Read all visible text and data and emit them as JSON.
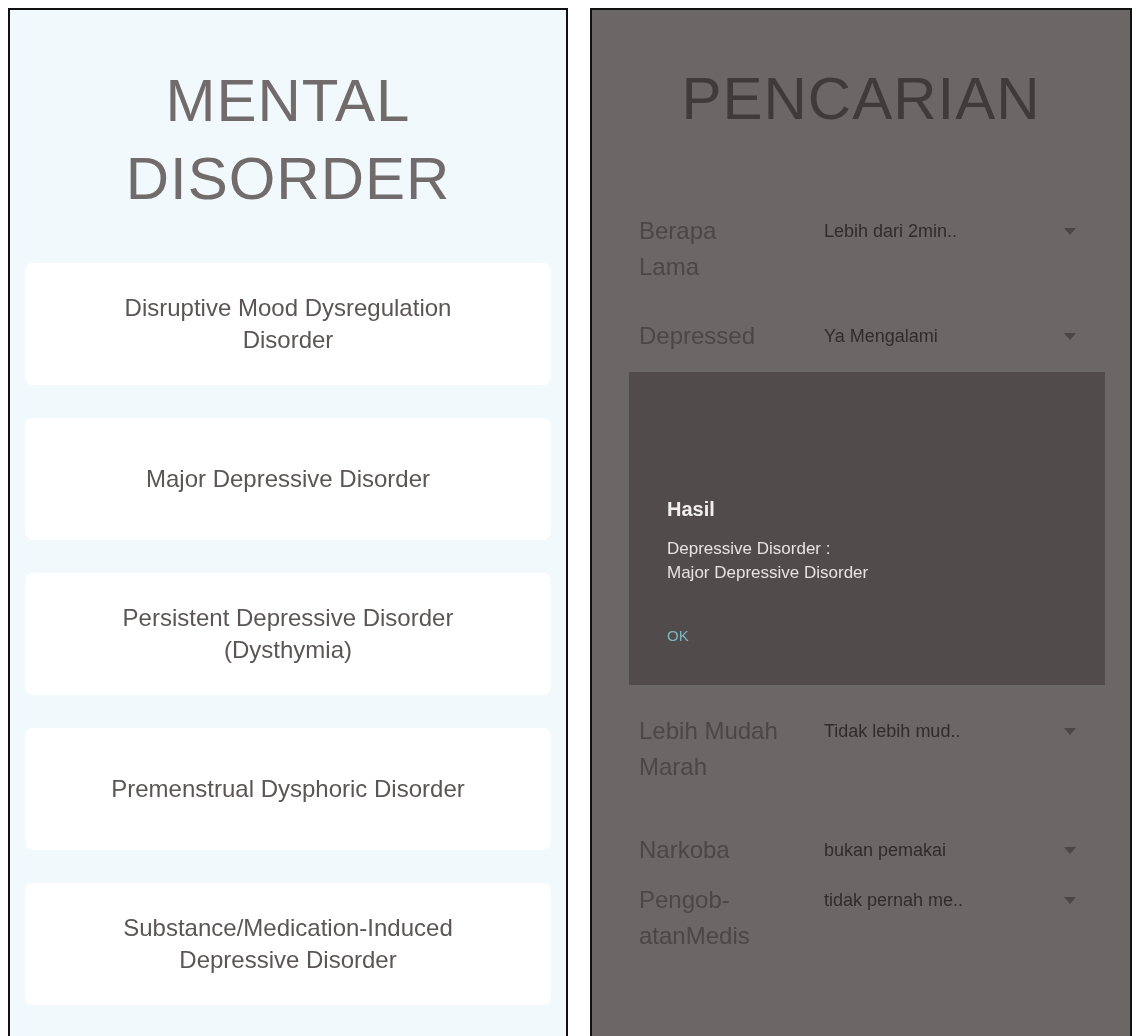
{
  "left_screen": {
    "title": "MENTAL DISORDER",
    "items": [
      {
        "label": "Disruptive Mood Dysregulation Disorder"
      },
      {
        "label": "Major Depressive Disorder"
      },
      {
        "label": "Persistent Depressive Disorder (Dysthymia)"
      },
      {
        "label": "Premenstrual Dysphoric Disorder"
      },
      {
        "label": "Substance/Medication-Induced Depressive Disorder"
      }
    ]
  },
  "right_screen": {
    "title": "PENCARIAN",
    "rows_above_dialog": [
      {
        "label": "Berapa Lama",
        "value": "Lebih dari 2min.."
      },
      {
        "label": "Depressed",
        "value": "Ya Mengalami"
      }
    ],
    "rows_below_dialog": [
      {
        "label": "Lebih Mudah Marah",
        "value": "Tidak lebih mud.."
      },
      {
        "label": "Narkoba",
        "value": "bukan pemakai"
      },
      {
        "label": "Pengob-atanMedis",
        "value": "tidak pernah me.."
      }
    ],
    "dialog": {
      "title": "Hasil",
      "message_lines": [
        "Depressive Disorder :",
        "Major Depressive Disorder"
      ],
      "button": "OK"
    }
  }
}
